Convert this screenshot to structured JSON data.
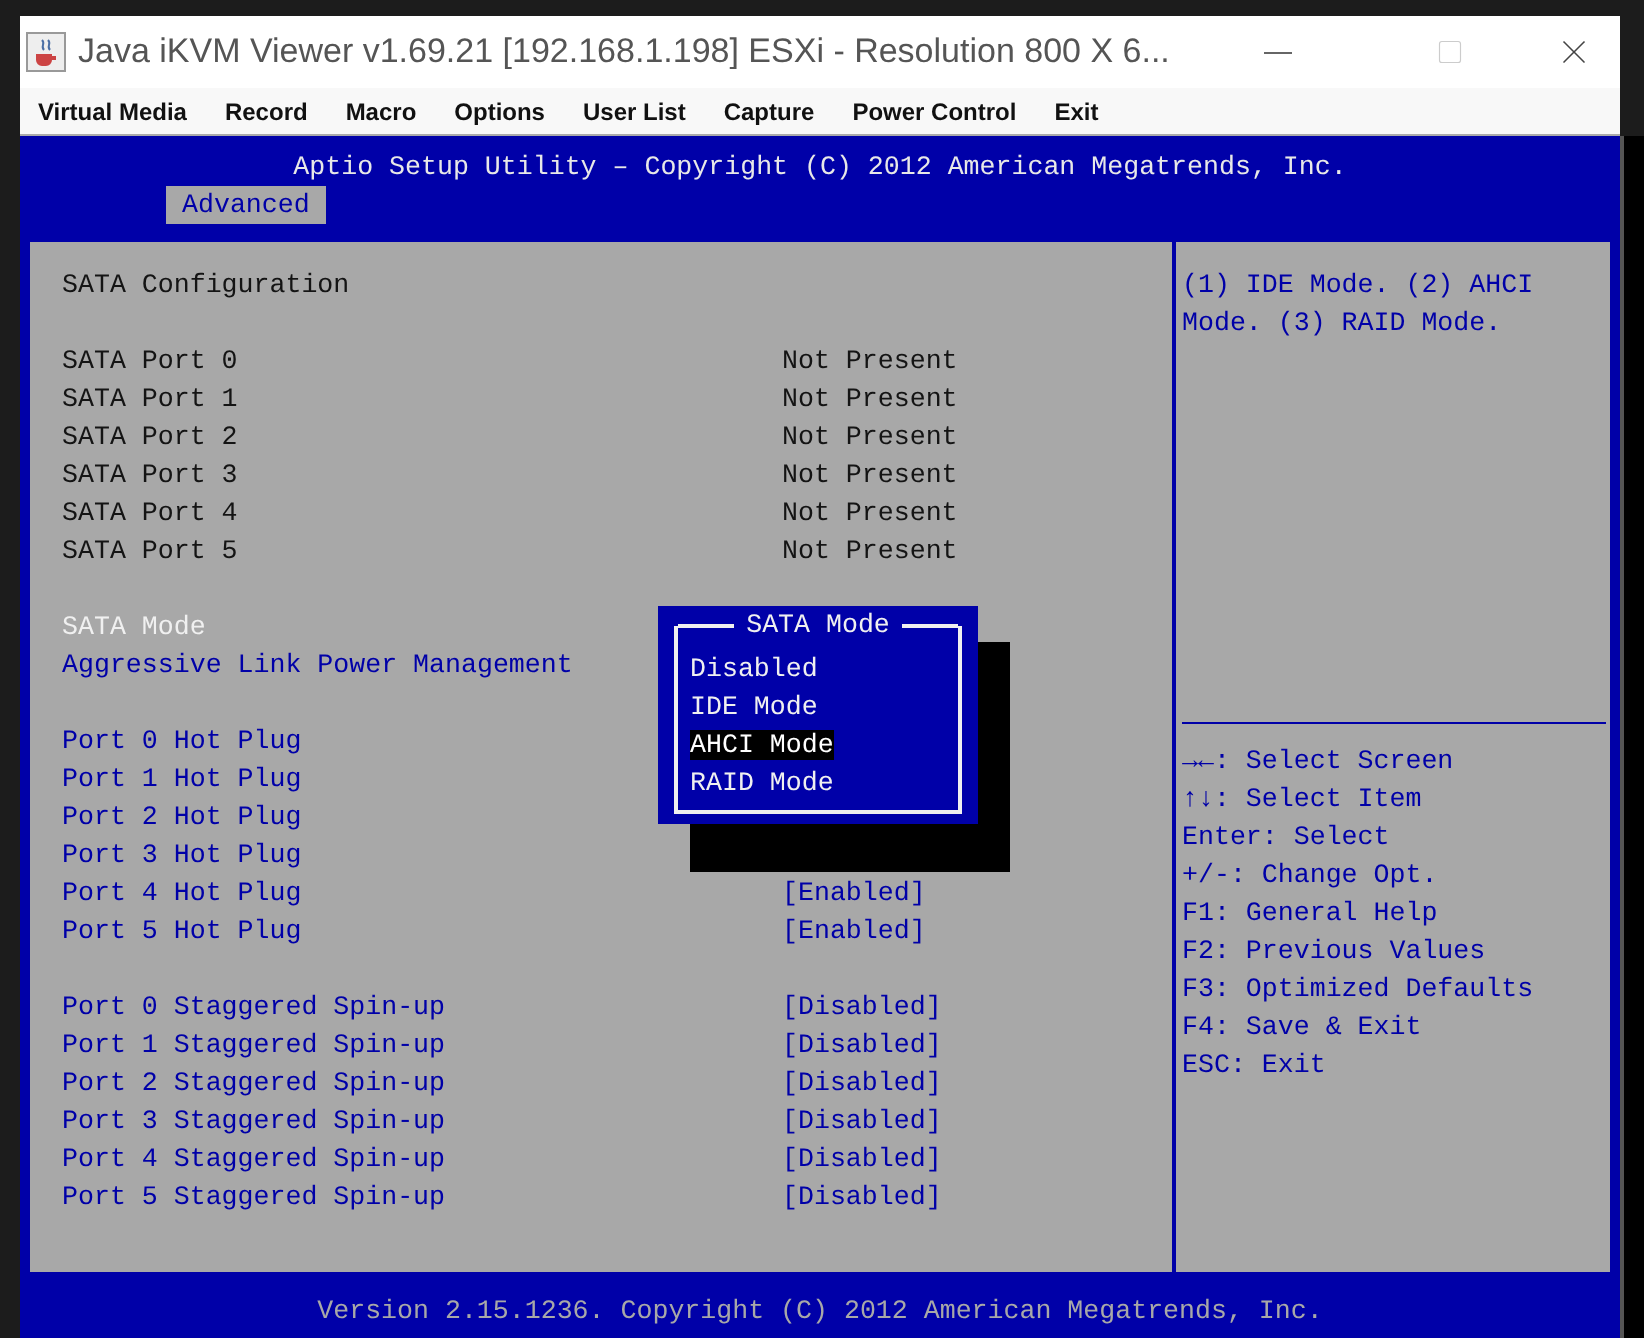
{
  "window": {
    "title": "Java iKVM Viewer v1.69.21 [192.168.1.198] ESXi - Resolution 800 X 6..."
  },
  "menu": [
    "Virtual Media",
    "Record",
    "Macro",
    "Options",
    "User List",
    "Capture",
    "Power Control",
    "Exit"
  ],
  "bios": {
    "header": "Aptio Setup Utility – Copyright (C) 2012 American Megatrends, Inc.",
    "tabs": [
      {
        "label": "Advanced",
        "selected": true
      }
    ],
    "rows": [
      {
        "kind": "info",
        "label": "SATA Configuration"
      },
      {
        "kind": "spacer"
      },
      {
        "kind": "info",
        "label": "SATA Port 0",
        "value": "Not Present"
      },
      {
        "kind": "info",
        "label": "SATA Port 1",
        "value": "Not Present"
      },
      {
        "kind": "info",
        "label": "SATA Port 2",
        "value": "Not Present"
      },
      {
        "kind": "info",
        "label": "SATA Port 3",
        "value": "Not Present"
      },
      {
        "kind": "info",
        "label": "SATA Port 4",
        "value": "Not Present"
      },
      {
        "kind": "info",
        "label": "SATA Port 5",
        "value": "Not Present"
      },
      {
        "kind": "spacer"
      },
      {
        "kind": "current",
        "label": "SATA Mode"
      },
      {
        "kind": "setting",
        "label": "Aggressive Link Power Management"
      },
      {
        "kind": "spacer"
      },
      {
        "kind": "setting",
        "label": "Port 0 Hot Plug"
      },
      {
        "kind": "setting",
        "label": "Port 1 Hot Plug"
      },
      {
        "kind": "setting",
        "label": "Port 2 Hot Plug"
      },
      {
        "kind": "setting",
        "label": "Port 3 Hot Plug"
      },
      {
        "kind": "setting",
        "label": "Port 4 Hot Plug",
        "value": "[Enabled]"
      },
      {
        "kind": "setting",
        "label": "Port 5 Hot Plug",
        "value": "[Enabled]"
      },
      {
        "kind": "spacer"
      },
      {
        "kind": "setting",
        "label": "Port 0 Staggered Spin-up",
        "value": "[Disabled]"
      },
      {
        "kind": "setting",
        "label": "Port 1 Staggered Spin-up",
        "value": "[Disabled]"
      },
      {
        "kind": "setting",
        "label": "Port 2 Staggered Spin-up",
        "value": "[Disabled]"
      },
      {
        "kind": "setting",
        "label": "Port 3 Staggered Spin-up",
        "value": "[Disabled]"
      },
      {
        "kind": "setting",
        "label": "Port 4 Staggered Spin-up",
        "value": "[Disabled]"
      },
      {
        "kind": "setting",
        "label": "Port 5 Staggered Spin-up",
        "value": "[Disabled]"
      }
    ],
    "popup": {
      "title": "SATA Mode",
      "options": [
        {
          "label": "Disabled",
          "selected": false
        },
        {
          "label": "IDE Mode",
          "selected": false
        },
        {
          "label": "AHCI Mode",
          "selected": true
        },
        {
          "label": "RAID Mode",
          "selected": false
        }
      ]
    },
    "help": "(1) IDE Mode. (2) AHCI Mode. (3) RAID Mode.",
    "keys": [
      "→←: Select Screen",
      "↑↓: Select Item",
      "Enter: Select",
      "+/-: Change Opt.",
      "F1: General Help",
      "F2: Previous Values",
      "F3: Optimized Defaults",
      "F4: Save & Exit",
      "ESC: Exit"
    ],
    "footer": "Version 2.15.1236. Copyright (C) 2012 American Megatrends, Inc."
  }
}
